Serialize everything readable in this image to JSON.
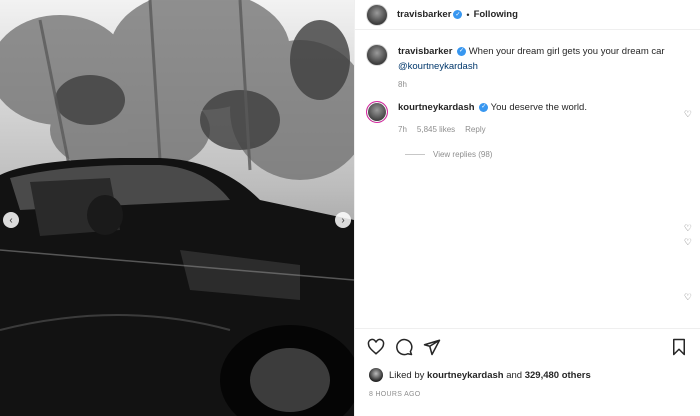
{
  "post": {
    "author": "travisbarker",
    "follow_status": "Following",
    "caption": "When your dream girl gets you your dream car",
    "caption_mention": "@kourtneykardash",
    "caption_time": "8h"
  },
  "comment": {
    "author": "kourtneykardash",
    "text": "You deserve the world.",
    "time": "7h",
    "likes": "5,845 likes",
    "reply_label": "Reply",
    "view_replies": "View replies (98)"
  },
  "likes": {
    "prefix": "Liked by",
    "user": "kourtneykardash",
    "and": "and",
    "others": "329,480 others"
  },
  "timestamp": "8 HOURS AGO",
  "icons": {
    "verified": "verified-badge-icon",
    "like": "heart-icon",
    "comment": "comment-bubble-icon",
    "share": "paper-plane-icon",
    "save": "bookmark-icon",
    "comment_like": "small-heart-icon",
    "prev": "chevron-left-icon",
    "next": "chevron-right-icon"
  },
  "colors": {
    "verified": "#3897f0",
    "mention": "#00376b",
    "muted": "#8e8e8e",
    "text": "#262626"
  }
}
